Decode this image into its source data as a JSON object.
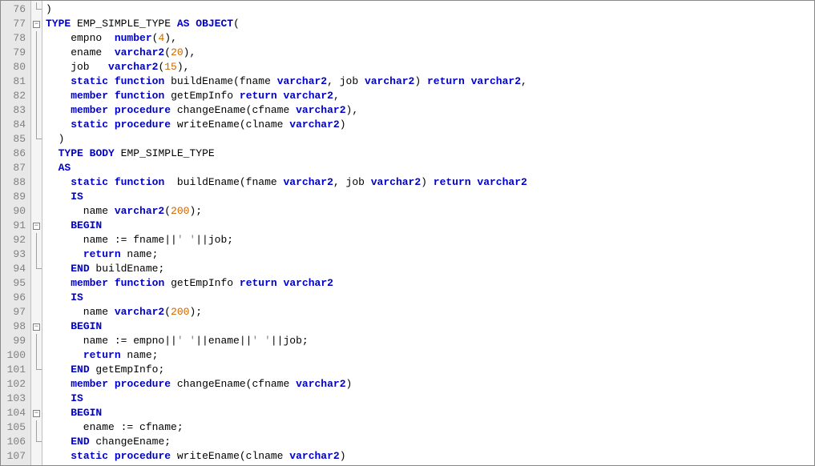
{
  "lines": [
    {
      "n": 76,
      "fold": "end",
      "tokens": [
        {
          "t": ")",
          "c": "pun"
        }
      ]
    },
    {
      "n": 77,
      "fold": "box",
      "tokens": [
        {
          "t": "TYPE",
          "c": "kw"
        },
        {
          "t": " EMP_SIMPLE_TYPE ",
          "c": "ident"
        },
        {
          "t": "AS",
          "c": "kw"
        },
        {
          "t": " ",
          "c": "ident"
        },
        {
          "t": "OBJECT",
          "c": "kw"
        },
        {
          "t": "(",
          "c": "pun"
        }
      ]
    },
    {
      "n": 78,
      "fold": "line",
      "tokens": [
        {
          "t": "    empno  ",
          "c": "ident"
        },
        {
          "t": "number",
          "c": "type"
        },
        {
          "t": "(",
          "c": "pun"
        },
        {
          "t": "4",
          "c": "num"
        },
        {
          "t": "),",
          "c": "pun"
        }
      ]
    },
    {
      "n": 79,
      "fold": "line",
      "tokens": [
        {
          "t": "    ename  ",
          "c": "ident"
        },
        {
          "t": "varchar2",
          "c": "type"
        },
        {
          "t": "(",
          "c": "pun"
        },
        {
          "t": "20",
          "c": "num"
        },
        {
          "t": "),",
          "c": "pun"
        }
      ]
    },
    {
      "n": 80,
      "fold": "line",
      "tokens": [
        {
          "t": "    job   ",
          "c": "ident"
        },
        {
          "t": "varchar2",
          "c": "type"
        },
        {
          "t": "(",
          "c": "pun"
        },
        {
          "t": "15",
          "c": "num"
        },
        {
          "t": "),",
          "c": "pun"
        }
      ]
    },
    {
      "n": 81,
      "fold": "line",
      "tokens": [
        {
          "t": "    ",
          "c": "ident"
        },
        {
          "t": "static",
          "c": "kw"
        },
        {
          "t": " ",
          "c": "ident"
        },
        {
          "t": "function",
          "c": "kw"
        },
        {
          "t": " buildEname(fname ",
          "c": "ident"
        },
        {
          "t": "varchar2",
          "c": "type"
        },
        {
          "t": ", job ",
          "c": "ident"
        },
        {
          "t": "varchar2",
          "c": "type"
        },
        {
          "t": ") ",
          "c": "ident"
        },
        {
          "t": "return",
          "c": "kw"
        },
        {
          "t": " ",
          "c": "ident"
        },
        {
          "t": "varchar2",
          "c": "type"
        },
        {
          "t": ",",
          "c": "pun"
        }
      ]
    },
    {
      "n": 82,
      "fold": "line",
      "tokens": [
        {
          "t": "    ",
          "c": "ident"
        },
        {
          "t": "member",
          "c": "kw"
        },
        {
          "t": " ",
          "c": "ident"
        },
        {
          "t": "function",
          "c": "kw"
        },
        {
          "t": " getEmpInfo ",
          "c": "ident"
        },
        {
          "t": "return",
          "c": "kw"
        },
        {
          "t": " ",
          "c": "ident"
        },
        {
          "t": "varchar2",
          "c": "type"
        },
        {
          "t": ",",
          "c": "pun"
        }
      ]
    },
    {
      "n": 83,
      "fold": "line",
      "tokens": [
        {
          "t": "    ",
          "c": "ident"
        },
        {
          "t": "member",
          "c": "kw"
        },
        {
          "t": " ",
          "c": "ident"
        },
        {
          "t": "procedure",
          "c": "kw"
        },
        {
          "t": " changeEname(cfname ",
          "c": "ident"
        },
        {
          "t": "varchar2",
          "c": "type"
        },
        {
          "t": "),",
          "c": "pun"
        }
      ]
    },
    {
      "n": 84,
      "fold": "line",
      "tokens": [
        {
          "t": "    ",
          "c": "ident"
        },
        {
          "t": "static",
          "c": "kw"
        },
        {
          "t": " ",
          "c": "ident"
        },
        {
          "t": "procedure",
          "c": "kw"
        },
        {
          "t": " writeEname(clname ",
          "c": "ident"
        },
        {
          "t": "varchar2",
          "c": "type"
        },
        {
          "t": ")",
          "c": "pun"
        }
      ]
    },
    {
      "n": 85,
      "fold": "end",
      "tokens": [
        {
          "t": "  )",
          "c": "pun"
        }
      ]
    },
    {
      "n": 86,
      "fold": "",
      "tokens": [
        {
          "t": "  ",
          "c": "ident"
        },
        {
          "t": "TYPE",
          "c": "kw"
        },
        {
          "t": " ",
          "c": "ident"
        },
        {
          "t": "BODY",
          "c": "kw"
        },
        {
          "t": " EMP_SIMPLE_TYPE",
          "c": "ident"
        }
      ]
    },
    {
      "n": 87,
      "fold": "",
      "tokens": [
        {
          "t": "  ",
          "c": "ident"
        },
        {
          "t": "AS",
          "c": "kw"
        }
      ]
    },
    {
      "n": 88,
      "fold": "",
      "tokens": [
        {
          "t": "    ",
          "c": "ident"
        },
        {
          "t": "static",
          "c": "kw"
        },
        {
          "t": " ",
          "c": "ident"
        },
        {
          "t": "function",
          "c": "kw"
        },
        {
          "t": "  buildEname(fname ",
          "c": "ident"
        },
        {
          "t": "varchar2",
          "c": "type"
        },
        {
          "t": ", job ",
          "c": "ident"
        },
        {
          "t": "varchar2",
          "c": "type"
        },
        {
          "t": ") ",
          "c": "ident"
        },
        {
          "t": "return",
          "c": "kw"
        },
        {
          "t": " ",
          "c": "ident"
        },
        {
          "t": "varchar2",
          "c": "type"
        }
      ]
    },
    {
      "n": 89,
      "fold": "",
      "tokens": [
        {
          "t": "    ",
          "c": "ident"
        },
        {
          "t": "IS",
          "c": "kw"
        }
      ]
    },
    {
      "n": 90,
      "fold": "",
      "tokens": [
        {
          "t": "      name ",
          "c": "ident"
        },
        {
          "t": "varchar2",
          "c": "type"
        },
        {
          "t": "(",
          "c": "pun"
        },
        {
          "t": "200",
          "c": "num"
        },
        {
          "t": ");",
          "c": "pun"
        }
      ]
    },
    {
      "n": 91,
      "fold": "box",
      "tokens": [
        {
          "t": "    ",
          "c": "ident"
        },
        {
          "t": "BEGIN",
          "c": "kw"
        }
      ]
    },
    {
      "n": 92,
      "fold": "line",
      "tokens": [
        {
          "t": "      name := fname||",
          "c": "ident"
        },
        {
          "t": "' '",
          "c": "str"
        },
        {
          "t": "||job;",
          "c": "ident"
        }
      ]
    },
    {
      "n": 93,
      "fold": "line",
      "tokens": [
        {
          "t": "      ",
          "c": "ident"
        },
        {
          "t": "return",
          "c": "kw"
        },
        {
          "t": " name;",
          "c": "ident"
        }
      ]
    },
    {
      "n": 94,
      "fold": "end",
      "tokens": [
        {
          "t": "    ",
          "c": "ident"
        },
        {
          "t": "END",
          "c": "kw"
        },
        {
          "t": " buildEname;",
          "c": "ident"
        }
      ]
    },
    {
      "n": 95,
      "fold": "",
      "tokens": [
        {
          "t": "    ",
          "c": "ident"
        },
        {
          "t": "member",
          "c": "kw"
        },
        {
          "t": " ",
          "c": "ident"
        },
        {
          "t": "function",
          "c": "kw"
        },
        {
          "t": " getEmpInfo ",
          "c": "ident"
        },
        {
          "t": "return",
          "c": "kw"
        },
        {
          "t": " ",
          "c": "ident"
        },
        {
          "t": "varchar2",
          "c": "type"
        }
      ]
    },
    {
      "n": 96,
      "fold": "",
      "tokens": [
        {
          "t": "    ",
          "c": "ident"
        },
        {
          "t": "IS",
          "c": "kw"
        }
      ]
    },
    {
      "n": 97,
      "fold": "",
      "tokens": [
        {
          "t": "      name ",
          "c": "ident"
        },
        {
          "t": "varchar2",
          "c": "type"
        },
        {
          "t": "(",
          "c": "pun"
        },
        {
          "t": "200",
          "c": "num"
        },
        {
          "t": ");",
          "c": "pun"
        }
      ]
    },
    {
      "n": 98,
      "fold": "box",
      "tokens": [
        {
          "t": "    ",
          "c": "ident"
        },
        {
          "t": "BEGIN",
          "c": "kw"
        }
      ]
    },
    {
      "n": 99,
      "fold": "line",
      "tokens": [
        {
          "t": "      name := empno||",
          "c": "ident"
        },
        {
          "t": "' '",
          "c": "str"
        },
        {
          "t": "||ename||",
          "c": "ident"
        },
        {
          "t": "' '",
          "c": "str"
        },
        {
          "t": "||job;",
          "c": "ident"
        }
      ]
    },
    {
      "n": 100,
      "fold": "line",
      "tokens": [
        {
          "t": "      ",
          "c": "ident"
        },
        {
          "t": "return",
          "c": "kw"
        },
        {
          "t": " name;",
          "c": "ident"
        }
      ]
    },
    {
      "n": 101,
      "fold": "end",
      "tokens": [
        {
          "t": "    ",
          "c": "ident"
        },
        {
          "t": "END",
          "c": "kw"
        },
        {
          "t": " getEmpInfo;",
          "c": "ident"
        }
      ]
    },
    {
      "n": 102,
      "fold": "",
      "tokens": [
        {
          "t": "    ",
          "c": "ident"
        },
        {
          "t": "member",
          "c": "kw"
        },
        {
          "t": " ",
          "c": "ident"
        },
        {
          "t": "procedure",
          "c": "kw"
        },
        {
          "t": " changeEname(cfname ",
          "c": "ident"
        },
        {
          "t": "varchar2",
          "c": "type"
        },
        {
          "t": ")",
          "c": "pun"
        }
      ]
    },
    {
      "n": 103,
      "fold": "",
      "tokens": [
        {
          "t": "    ",
          "c": "ident"
        },
        {
          "t": "IS",
          "c": "kw"
        }
      ]
    },
    {
      "n": 104,
      "fold": "box",
      "tokens": [
        {
          "t": "    ",
          "c": "ident"
        },
        {
          "t": "BEGIN",
          "c": "kw"
        }
      ]
    },
    {
      "n": 105,
      "fold": "line",
      "tokens": [
        {
          "t": "      ename := cfname;",
          "c": "ident"
        }
      ]
    },
    {
      "n": 106,
      "fold": "end",
      "tokens": [
        {
          "t": "    ",
          "c": "ident"
        },
        {
          "t": "END",
          "c": "kw"
        },
        {
          "t": " changeEname;",
          "c": "ident"
        }
      ]
    },
    {
      "n": 107,
      "fold": "",
      "tokens": [
        {
          "t": "    ",
          "c": "ident"
        },
        {
          "t": "static",
          "c": "kw"
        },
        {
          "t": " ",
          "c": "ident"
        },
        {
          "t": "procedure",
          "c": "kw"
        },
        {
          "t": " writeEname(clname ",
          "c": "ident"
        },
        {
          "t": "varchar2",
          "c": "type"
        },
        {
          "t": ")",
          "c": "pun"
        }
      ]
    }
  ]
}
